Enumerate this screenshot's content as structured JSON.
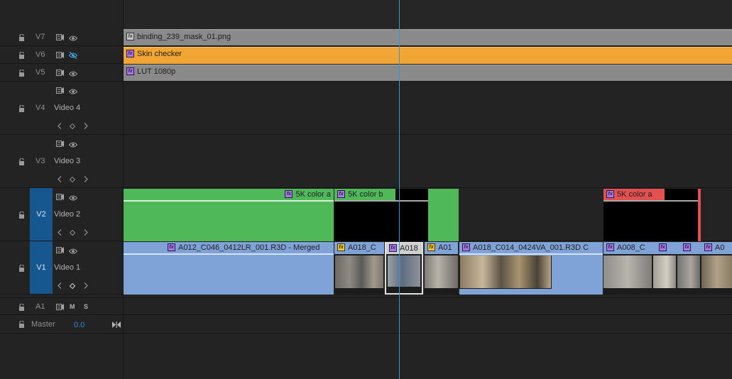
{
  "tracks": {
    "V7": {
      "name": "V7",
      "clip": "binding_239_mask_01.png"
    },
    "V6": {
      "name": "V6",
      "clip": "Skin checker"
    },
    "V5": {
      "name": "V5",
      "clip": "LUT 1080p"
    },
    "V4": {
      "name": "V4",
      "label": "Video 4"
    },
    "V3": {
      "name": "V3",
      "label": "Video 3"
    },
    "V2": {
      "name": "V2",
      "label": "Video 2",
      "clips": [
        "5K color a",
        "5K color b",
        "5K color a"
      ]
    },
    "V1": {
      "name": "V1",
      "label": "Video 1",
      "clips": [
        "A012_C046_0412LR_001.R3D - Merged",
        "A018_C",
        "A018",
        "A01",
        "A018_C014_0424VA_001.R3D C",
        "A008_C",
        "A0"
      ]
    },
    "A1": {
      "name": "A1",
      "mute": "M",
      "solo": "S"
    },
    "master": {
      "name": "Master",
      "value": "0.0"
    }
  },
  "colors": {
    "background": "#232323",
    "adjustment_clip": "#8a8a8a",
    "skin_checker": "#f0a535",
    "v2_green": "#4fb95a",
    "v2_red": "#e45050",
    "v1_blue": "#7fa3d6",
    "selection_blue": "#17578f",
    "playhead": "#2e9ad8"
  },
  "icons": [
    "lock-icon",
    "track-output-icon",
    "eye-icon",
    "eye-off-icon",
    "prev-keyframe-icon",
    "add-keyframe-icon",
    "next-keyframe-icon",
    "fx-badge-icon",
    "master-end-icon"
  ]
}
